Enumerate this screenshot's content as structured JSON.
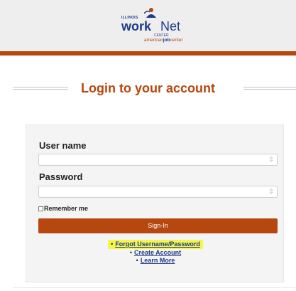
{
  "header": {
    "logo": {
      "state": "ILLINOIS",
      "work": "work",
      "net": "Net",
      "center": "CENTER",
      "ajc_prefix": "american",
      "ajc_bold": "job",
      "ajc_suffix": "center"
    },
    "accent_color": "#b5470f"
  },
  "title": "Login to your account",
  "form": {
    "username_label": "User name",
    "username_value": "",
    "password_label": "Password",
    "password_value": "",
    "field_icon": "⇕",
    "remember_label": "Remember me",
    "signin_label": "Sign-In"
  },
  "links": {
    "bullet": "•",
    "forgot": "Forgot Username/Password",
    "create": "Create Account",
    "learn": "Learn More"
  }
}
